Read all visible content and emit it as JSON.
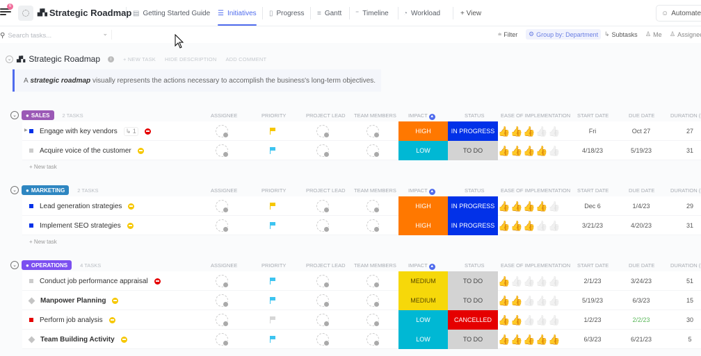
{
  "topbar": {
    "notification_count": "6",
    "space_title": "Strategic Roadmap",
    "tabs": [
      {
        "label": "Getting Started Guide",
        "icon": "doc-icon",
        "active": false
      },
      {
        "label": "Initiatives",
        "icon": "list-icon",
        "active": true
      },
      {
        "label": "Progress",
        "icon": "board-icon",
        "active": false
      },
      {
        "label": "Gantt",
        "icon": "gantt-icon",
        "active": false
      },
      {
        "label": "Timeline",
        "icon": "timeline-icon",
        "active": false
      },
      {
        "label": "Workload",
        "icon": "workload-icon",
        "active": false
      }
    ],
    "add_view": "+ View",
    "automate": "Automate"
  },
  "toolbar": {
    "search_placeholder": "Search tasks...",
    "filter": "Filter",
    "group_by": "Group by: Department",
    "subtasks": "Subtasks",
    "me": "Me",
    "assignees": "Assignees"
  },
  "list": {
    "title": "Strategic Roadmap",
    "new_task": "+ NEW TASK",
    "hide_description": "HIDE DESCRIPTION",
    "add_comment": "ADD COMMENT",
    "description_prefix": "A",
    "description_bold": "strategic roadmap",
    "description_rest": "visually represents the actions necessary to accomplish the business's long-term objectives."
  },
  "columns": {
    "assignee": "ASSIGNEE",
    "priority": "PRIORITY",
    "project_lead": "PROJECT LEAD",
    "team_members": "TEAM MEMBERS",
    "impact": "IMPACT",
    "status": "STATUS",
    "ease": "EASE OF IMPLEMENTATION",
    "start_date": "START DATE",
    "due_date": "DUE DATE",
    "duration": "DURATION (D"
  },
  "colors": {
    "accent": "#4f6bed",
    "high": "#ff7800",
    "low": "#00b8d4",
    "medium": "#f6d80a",
    "in_progress": "#0231e8",
    "to_do": "#d3d3d3",
    "cancelled": "#e50000"
  },
  "new_task_label": "+ New task",
  "groups": [
    {
      "name": "SALES",
      "count": "2 TASKS",
      "color": "#9b59b6",
      "tasks": [
        {
          "name": "Engage with key vendors",
          "square": "#0231e8",
          "subtasks": "1",
          "prio_dot": "#e50000",
          "flag": "#f6c700",
          "impact": "HIGH",
          "status": "IN PROGRESS",
          "ease": 3,
          "start": "Fri",
          "due": "Oct 27",
          "duration": "27",
          "bold": false,
          "expand": true
        },
        {
          "name": "Acquire voice of the customer",
          "square": "#cccccc",
          "prio_dot": "#f6c700",
          "flag": "#3dc4f0",
          "impact": "LOW",
          "status": "TO DO",
          "ease": 4,
          "start": "4/18/23",
          "due": "5/19/23",
          "duration": "31",
          "bold": false
        }
      ]
    },
    {
      "name": "MARKETING",
      "count": "2 TASKS",
      "color": "#2e86c1",
      "tasks": [
        {
          "name": "Lead generation strategies",
          "square": "#0231e8",
          "prio_dot": "#f6c700",
          "flag": "#f6c700",
          "impact": "HIGH",
          "status": "IN PROGRESS",
          "ease": 4,
          "start": "Dec 6",
          "due": "1/4/23",
          "duration": "29",
          "bold": false
        },
        {
          "name": "Implement SEO strategies",
          "square": "#0231e8",
          "prio_dot": "#f6c700",
          "flag": "#3dc4f0",
          "impact": "HIGH",
          "status": "IN PROGRESS",
          "ease": 3,
          "start": "3/21/23",
          "due": "4/20/23",
          "duration": "31",
          "bold": false
        }
      ]
    },
    {
      "name": "OPERATIONS",
      "count": "4 TASKS",
      "color": "#7b4ff0",
      "tasks": [
        {
          "name": "Conduct job performance appraisal",
          "square": "#cccccc",
          "prio_dot": "#e50000",
          "flag": "#3dc4f0",
          "impact": "MEDIUM",
          "status": "TO DO",
          "ease": 1,
          "start": "2/1/23",
          "due": "3/24/23",
          "duration": "51",
          "bold": false
        },
        {
          "name": "Manpower Planning",
          "square": "diamond",
          "prio_dot": "#f6c700",
          "flag": "#3dc4f0",
          "impact": "MEDIUM",
          "status": "TO DO",
          "ease": 2,
          "start": "5/19/23",
          "due": "6/3/23",
          "duration": "15",
          "bold": true
        },
        {
          "name": "Perform job analysis",
          "square": "#e50000",
          "prio_dot": "#f6c700",
          "flag": "#d6d6d6",
          "impact": "LOW",
          "status": "CANCELLED",
          "ease": 2,
          "start": "1/2/23",
          "due": "2/2/23",
          "due_color": "#5cb85c",
          "duration": "30",
          "bold": false
        },
        {
          "name": "Team Building Activity",
          "square": "diamond",
          "prio_dot": "#f6c700",
          "flag": "#3dc4f0",
          "impact": "LOW",
          "status": "TO DO",
          "ease": 5,
          "start": "6/3/23",
          "due": "6/21/23",
          "duration": "5",
          "bold": true
        }
      ]
    }
  ]
}
